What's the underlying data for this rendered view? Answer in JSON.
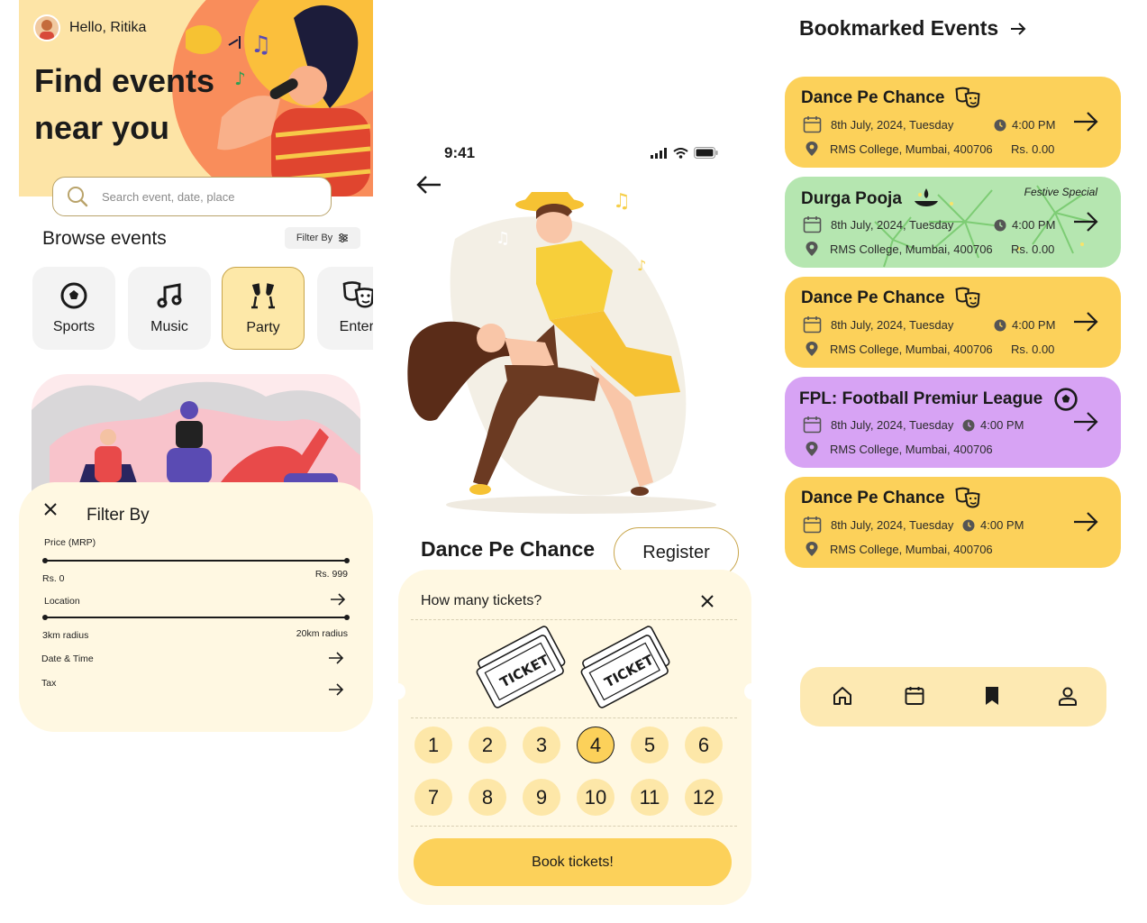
{
  "home": {
    "greeting": "Hello, Ritika",
    "hero_title": "Find events near you",
    "search_placeholder": "Search event, date, place",
    "browse_title": "Browse events",
    "filter_chip": "Filter By",
    "categories": [
      {
        "label": "Sports",
        "icon": "football-icon"
      },
      {
        "label": "Music",
        "icon": "music-note-icon"
      },
      {
        "label": "Party",
        "icon": "cheers-icon",
        "active": true
      },
      {
        "label": "Entert",
        "icon": "theater-masks-icon"
      }
    ]
  },
  "filter": {
    "title": "Filter By",
    "price_label": "Price (MRP)",
    "price_min": "Rs. 0",
    "price_max": "Rs. 999",
    "location_label": "Location",
    "radius_min": "3km radius",
    "radius_max": "20km radius",
    "date_label": "Date & Time",
    "tax_label": "Tax"
  },
  "detail": {
    "status_time": "9:41",
    "event_title": "Dance Pe Chance",
    "register_label": "Register",
    "ticket_question": "How many tickets?",
    "ticket_art_text": "TICKET",
    "numbers": [
      "1",
      "2",
      "3",
      "4",
      "5",
      "6",
      "7",
      "8",
      "9",
      "10",
      "11",
      "12"
    ],
    "selected": "4",
    "book_label": "Book tickets!"
  },
  "bookmarks": {
    "title": "Bookmarked Events",
    "cards": [
      {
        "title": "Dance Pe Chance",
        "date": "8th July, 2024, Tuesday",
        "time": "4:00 PM",
        "place": "RMS College, Mumbai, 400706",
        "price": "Rs. 0.00",
        "color": "#fcd15a"
      },
      {
        "title": "Durga Pooja",
        "date": "8th July, 2024, Tuesday",
        "time": "4:00 PM",
        "place": "RMS College, Mumbai, 400706",
        "price": "Rs. 0.00",
        "tag": "Festive Special",
        "color": "#b5e6b0"
      },
      {
        "title": "Dance Pe Chance",
        "date": "8th July, 2024, Tuesday",
        "time": "4:00 PM",
        "place": "RMS College, Mumbai, 400706",
        "price": "Rs. 0.00",
        "color": "#fcd15a"
      },
      {
        "title": "FPL: Football Premiur League",
        "date": "8th July, 2024, Tuesday",
        "time": "4:00 PM",
        "place": "RMS College, Mumbai, 400706",
        "color": "#d7a3f4"
      },
      {
        "title": "Dance Pe Chance",
        "date": "8th July, 2024, Tuesday",
        "time": "4:00 PM",
        "place": "RMS College, Mumbai, 400706",
        "color": "#fcd15a"
      }
    ],
    "nav": [
      "home-icon",
      "calendar-icon",
      "bookmark-icon",
      "profile-icon"
    ]
  }
}
